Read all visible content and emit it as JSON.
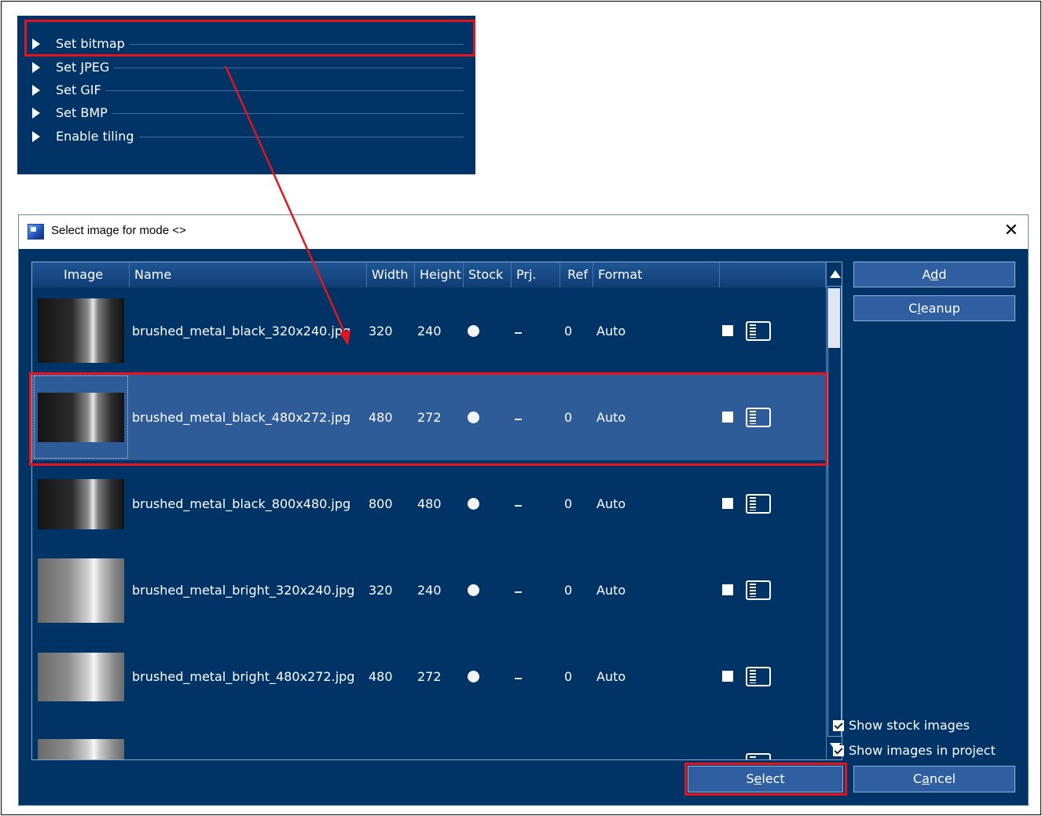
{
  "properties_panel": {
    "items": [
      {
        "label": "Set bitmap"
      },
      {
        "label": "Set JPEG"
      },
      {
        "label": "Set GIF"
      },
      {
        "label": "Set BMP"
      },
      {
        "label": "Enable tiling"
      }
    ]
  },
  "dialog": {
    "title": "Select image for mode <>",
    "close_label": "✕",
    "columns": [
      "Image",
      "Name",
      "Width",
      "Height",
      "Stock",
      "Prj.",
      "Ref",
      "Format"
    ],
    "rows": [
      {
        "name": "brushed_metal_black_320x240.jpg",
        "width": "320",
        "height": "240",
        "prj": "–",
        "ref": "0",
        "format": "Auto",
        "thumb": "dark"
      },
      {
        "name": "brushed_metal_black_480x272.jpg",
        "width": "480",
        "height": "272",
        "prj": "–",
        "ref": "0",
        "format": "Auto",
        "thumb": "dark",
        "selected": true
      },
      {
        "name": "brushed_metal_black_800x480.jpg",
        "width": "800",
        "height": "480",
        "prj": "–",
        "ref": "0",
        "format": "Auto",
        "thumb": "dark"
      },
      {
        "name": "brushed_metal_bright_320x240.jpg",
        "width": "320",
        "height": "240",
        "prj": "–",
        "ref": "0",
        "format": "Auto",
        "thumb": "bright"
      },
      {
        "name": "brushed_metal_bright_480x272.jpg",
        "width": "480",
        "height": "272",
        "prj": "–",
        "ref": "0",
        "format": "Auto",
        "thumb": "bright"
      }
    ],
    "buttons": {
      "add": {
        "pre": "A",
        "u": "d",
        "post": "d"
      },
      "cleanup": {
        "pre": "C",
        "u": "l",
        "post": "eanup"
      },
      "select": {
        "pre": "S",
        "u": "e",
        "post": "lect"
      },
      "cancel": {
        "pre": "C",
        "u": "a",
        "post": "ncel"
      }
    },
    "options": {
      "show_stock": "Show stock images",
      "show_project": "Show images in project"
    }
  },
  "colors": {
    "background": "#003366",
    "selected_row": "#2e5c99",
    "highlight": "#e8131a"
  }
}
